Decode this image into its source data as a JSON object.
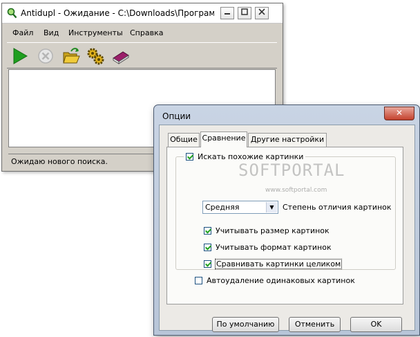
{
  "main_window": {
    "title": "Antidupl - Ожидание - C:\\Downloads\\Программ...",
    "menu": [
      "Файл",
      "Вид",
      "Инструменты",
      "Справка"
    ],
    "toolbar": [
      {
        "name": "start",
        "icon": "play-icon"
      },
      {
        "name": "stop",
        "icon": "stop-icon"
      },
      {
        "name": "open-folder",
        "icon": "open-folder-icon"
      },
      {
        "name": "options",
        "icon": "gears-icon"
      },
      {
        "name": "help",
        "icon": "book-icon"
      }
    ],
    "status": "Ожидаю нового поиска."
  },
  "dialog": {
    "title": "Опции",
    "close_glyph": "✕",
    "tabs": [
      {
        "label": "Общие",
        "active": false
      },
      {
        "label": "Сравнение",
        "active": true
      },
      {
        "label": "Другие настройки",
        "active": false
      }
    ],
    "group": {
      "label": "Искать похожие картинки",
      "checked": true
    },
    "combo": {
      "value": "Средняя",
      "label": "Степень отличия картинок"
    },
    "options": [
      {
        "label": "Учитывать размер картинок",
        "checked": true
      },
      {
        "label": "Учитывать формат картинок",
        "checked": true
      },
      {
        "label": "Сравнивать картинки целиком",
        "checked": true
      },
      {
        "label": "Автоудаление одинаковых картинок",
        "checked": false
      }
    ],
    "buttons": {
      "default": "По умолчанию",
      "cancel": "Отменить",
      "ok": "OK"
    }
  },
  "watermark": {
    "text": "SOFTPORTAL",
    "url": "www.softportal.com"
  },
  "colors": {
    "window_bg": "#d4d0c8",
    "dialog_frame": "#c9d4e4",
    "close_button": "#c4412c",
    "play_green": "#1f9f1f"
  }
}
